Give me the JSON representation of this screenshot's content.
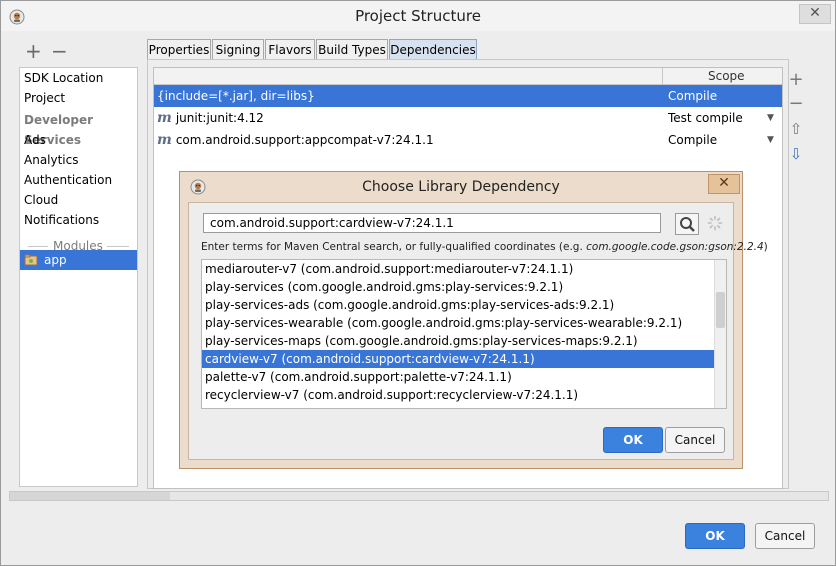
{
  "window": {
    "title": "Project Structure",
    "close_glyph": "✕",
    "icon": "android-studio-icon"
  },
  "left_toolbar": {
    "add": "+",
    "remove": "−"
  },
  "left_list": {
    "items": [
      {
        "label": "SDK Location",
        "header": false
      },
      {
        "label": "Project",
        "header": false
      },
      {
        "label": "Developer Services",
        "header": true
      },
      {
        "label": "Ads",
        "header": false
      },
      {
        "label": "Analytics",
        "header": false
      },
      {
        "label": "Authentication",
        "header": false
      },
      {
        "label": "Cloud",
        "header": false
      },
      {
        "label": "Notifications",
        "header": false
      }
    ],
    "modules_label": "Modules",
    "module_app": "app"
  },
  "tabs": [
    {
      "label": "Properties",
      "active": false
    },
    {
      "label": "Signing",
      "active": false
    },
    {
      "label": "Flavors",
      "active": false
    },
    {
      "label": "Build Types",
      "active": false
    },
    {
      "label": "Dependencies",
      "active": true
    }
  ],
  "dependencies": {
    "scope_header": "Scope",
    "rows": [
      {
        "name": "{include=[*.jar], dir=libs}",
        "scope": "Compile",
        "maven": false,
        "selected": true
      },
      {
        "name": "junit:junit:4.12",
        "scope": "Test compile",
        "maven": true,
        "selected": false
      },
      {
        "name": "com.android.support:appcompat-v7:24.1.1",
        "scope": "Compile",
        "maven": true,
        "selected": false
      }
    ],
    "maven_glyph": "m",
    "dropdown_glyph": "▼"
  },
  "side_buttons": {
    "add": "+",
    "remove": "−",
    "up": "⇧",
    "down": "⇩"
  },
  "dialog": {
    "title": "Choose Library Dependency",
    "close_glyph": "✕",
    "search_value": "com.android.support:cardview-v7:24.1.1",
    "hint_prefix": "Enter terms for Maven Central search, or fully-qualified coordinates (e.g. ",
    "hint_example": "com.google.code.gson:gson:2.2.4",
    "hint_suffix": ")",
    "results": [
      {
        "text": "mediarouter-v7 (com.android.support:mediarouter-v7:24.1.1)",
        "selected": false
      },
      {
        "text": "play-services (com.google.android.gms:play-services:9.2.1)",
        "selected": false
      },
      {
        "text": "play-services-ads (com.google.android.gms:play-services-ads:9.2.1)",
        "selected": false
      },
      {
        "text": "play-services-wearable (com.google.android.gms:play-services-wearable:9.2.1)",
        "selected": false
      },
      {
        "text": "play-services-maps (com.google.android.gms:play-services-maps:9.2.1)",
        "selected": false
      },
      {
        "text": "cardview-v7 (com.android.support:cardview-v7:24.1.1)",
        "selected": true
      },
      {
        "text": "palette-v7 (com.android.support:palette-v7:24.1.1)",
        "selected": false
      },
      {
        "text": "recyclerview-v7 (com.android.support:recyclerview-v7:24.1.1)",
        "selected": false
      }
    ],
    "ok_label": "OK",
    "cancel_label": "Cancel"
  },
  "footer": {
    "ok_label": "OK",
    "cancel_label": "Cancel"
  },
  "colors": {
    "selection": "#3875d7",
    "primary_button": "#3b82de",
    "dialog_frame": "#ecdccb"
  }
}
